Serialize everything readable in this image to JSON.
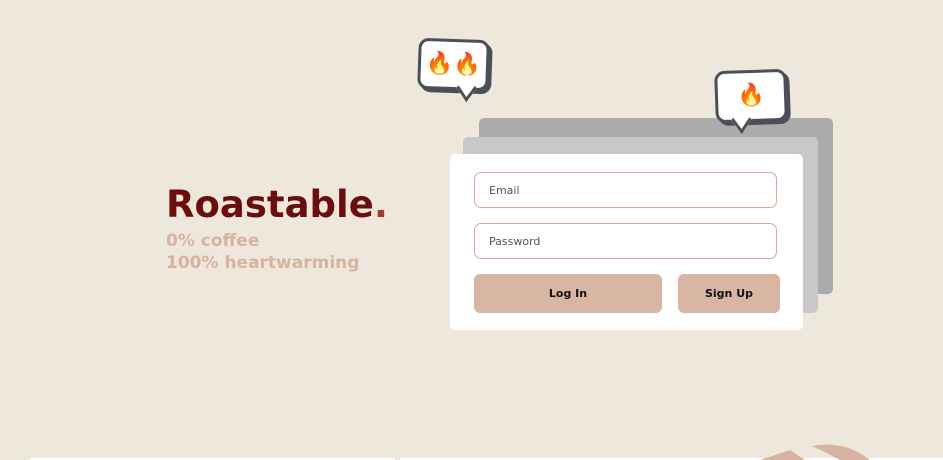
{
  "brand": {
    "name": "Roastable",
    "dot": ".",
    "tagline_line1": "0% coffee",
    "tagline_line2": "100% heartwarming"
  },
  "login_form": {
    "email_placeholder": "Email",
    "password_placeholder": "Password",
    "login_label": "Log In",
    "signup_label": "Sign Up"
  },
  "bubbles": {
    "left": "🔥🔥",
    "right": "🔥"
  },
  "colors": {
    "background": "#eee8dc",
    "brand": "#6b0d0d",
    "tagline": "#d8b3a0",
    "button": "#d8b6a3",
    "field_border": "#d8aa96"
  }
}
